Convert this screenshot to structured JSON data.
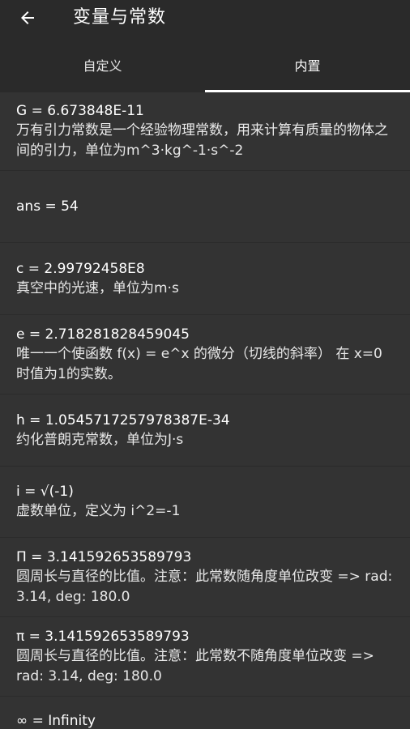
{
  "header": {
    "title": "变量与常数",
    "back_icon": "arrow-left-icon"
  },
  "tabs": [
    {
      "label": "自定义",
      "active": false
    },
    {
      "label": "内置",
      "active": true
    }
  ],
  "constants": [
    {
      "name": "G = 6.673848E-11",
      "desc": "万有引力常数是一个经验物理常数，用来计算有质量的物体之间的引力，单位为m^3·kg^-1·s^-2"
    },
    {
      "name": "ans = 54",
      "desc": ""
    },
    {
      "name": "c = 2.99792458E8",
      "desc": "真空中的光速，单位为m·s"
    },
    {
      "name": "e = 2.718281828459045",
      "desc": "唯一一个使函数 f(x) = e^x 的微分（切线的斜率） 在 x=0 时值为1的实数。"
    },
    {
      "name": "h = 1.0545717257978387E-34",
      "desc": "约化普朗克常数，单位为J·s"
    },
    {
      "name": "i = √(-1)",
      "desc": "虚数单位，定义为 i^2=-1"
    },
    {
      "name": "Π = 3.141592653589793",
      "desc": "圆周长与直径的比值。注意：此常数随角度单位改变 => rad: 3.14, deg: 180.0"
    },
    {
      "name": "π = 3.141592653589793",
      "desc": "圆周长与直径的比值。注意：此常数不随角度单位改变 => rad: 3.14, deg: 180.0"
    },
    {
      "name": "∞ = Infinity",
      "desc": ""
    }
  ]
}
